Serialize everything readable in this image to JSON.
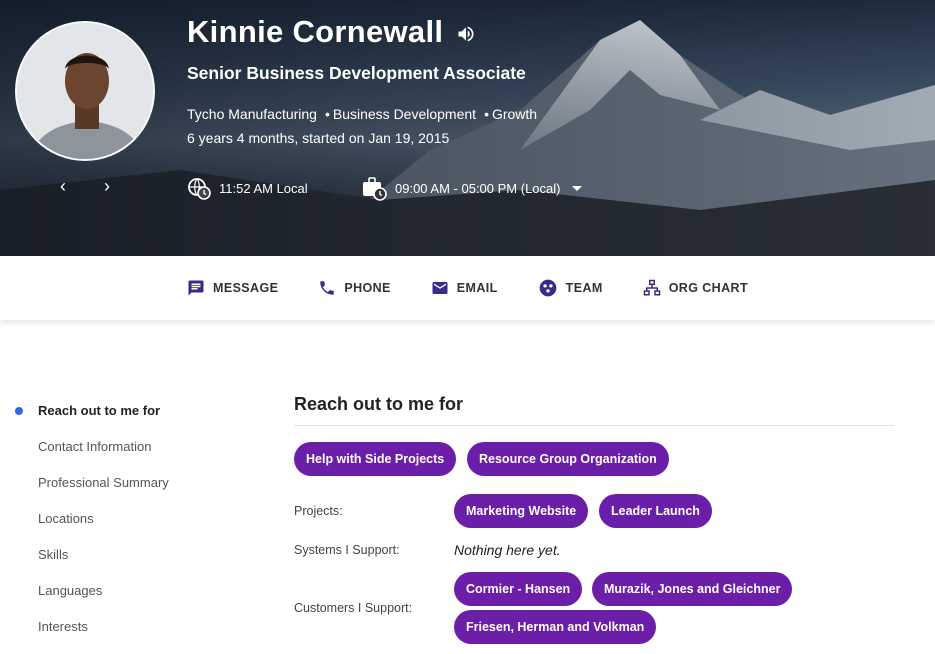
{
  "profile": {
    "name": "Kinnie Cornewall",
    "title": "Senior Business Development Associate",
    "company": "Tycho Manufacturing",
    "department": "Business Development",
    "group": "Growth",
    "tenure": "6 years 4 months, started on Jan 19, 2015",
    "local_time": "11:52 AM Local",
    "working_hours": "09:00 AM - 05:00 PM (Local)"
  },
  "actions": [
    {
      "label": "MESSAGE",
      "icon": "message-icon"
    },
    {
      "label": "PHONE",
      "icon": "phone-icon"
    },
    {
      "label": "EMAIL",
      "icon": "email-icon"
    },
    {
      "label": "TEAM",
      "icon": "team-icon"
    },
    {
      "label": "ORG CHART",
      "icon": "org-chart-icon"
    }
  ],
  "sidenav": [
    {
      "label": "Reach out to me for",
      "active": true
    },
    {
      "label": "Contact Information"
    },
    {
      "label": "Professional Summary"
    },
    {
      "label": "Locations"
    },
    {
      "label": "Skills"
    },
    {
      "label": "Languages"
    },
    {
      "label": "Interests"
    }
  ],
  "section": {
    "title": "Reach out to me for",
    "reach_chips": [
      "Help with Side Projects",
      "Resource Group Organization"
    ],
    "projects_label": "Projects:",
    "projects": [
      "Marketing Website",
      "Leader Launch"
    ],
    "systems_label": "Systems I Support:",
    "systems_empty": "Nothing here yet.",
    "customers_label": "Customers I Support:",
    "customers": [
      "Cormier - Hansen",
      "Murazik, Jones and Gleichner",
      "Friesen, Herman and Volkman"
    ]
  },
  "colors": {
    "chip": "#6b1fa8",
    "nav_bullet": "#3b63e0"
  }
}
